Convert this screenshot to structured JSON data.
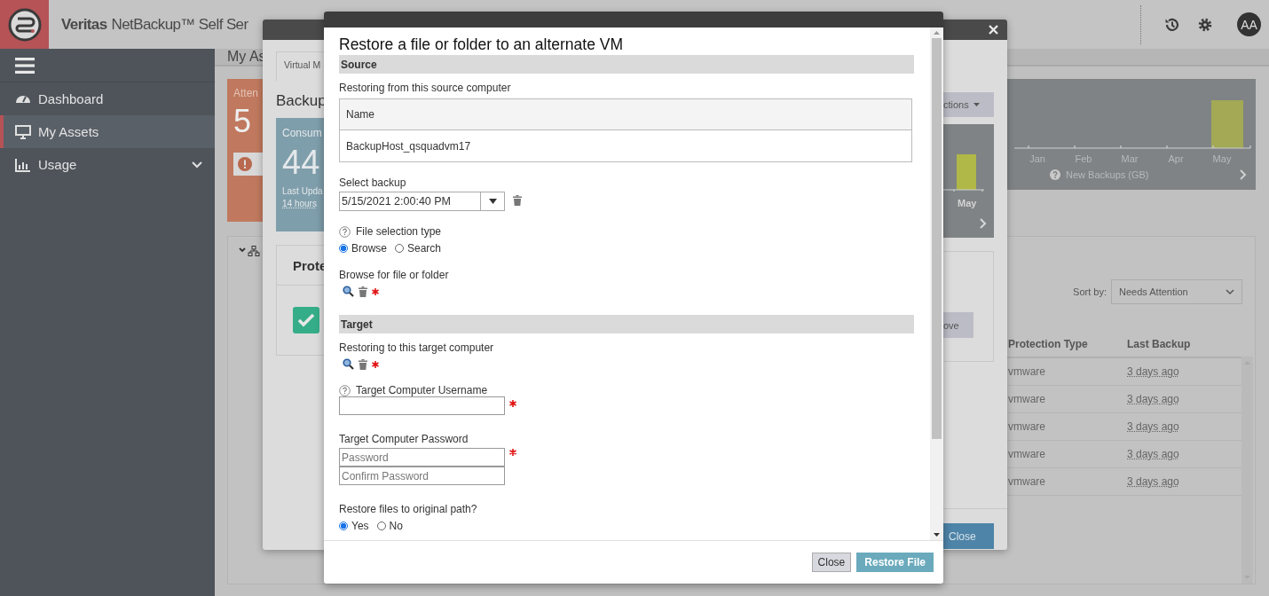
{
  "header": {
    "brand": "Veritas",
    "title": "NetBackup™ Self Ser",
    "avatar": "AA"
  },
  "sidebar": {
    "items": [
      {
        "label": "Dashboard",
        "kind": "dashboard",
        "selected": false,
        "expandable": false
      },
      {
        "label": "My Assets",
        "kind": "monitor",
        "selected": true,
        "expandable": false
      },
      {
        "label": "Usage",
        "kind": "chart",
        "selected": false,
        "expandable": true
      }
    ]
  },
  "page": {
    "breadcrumb": "My As",
    "attention": {
      "label": "Atten",
      "count": "5"
    },
    "chart": {
      "months": [
        "Jan",
        "Feb",
        "Mar",
        "Apr",
        "May"
      ],
      "caption": "New Backups (GB)"
    },
    "sort": {
      "label": "Sort by:",
      "value": "Needs Attention"
    },
    "table": {
      "columns": [
        "Protection Type",
        "Last Backup"
      ],
      "rows": [
        [
          "vmware",
          "3 days ago"
        ],
        [
          "vmware",
          "3 days ago"
        ],
        [
          "vmware",
          "3 days ago"
        ],
        [
          "vmware",
          "3 days ago"
        ],
        [
          "vmware",
          "3 days ago"
        ]
      ]
    }
  },
  "back_dialog": {
    "tab": "Virtual M",
    "title": "Backup",
    "card": {
      "label": "Consum",
      "value": "44",
      "updated": "Last Upda",
      "age": "14 hours"
    },
    "panel_title": "Prote",
    "actions": "ctions",
    "chart_label": "May",
    "remove": "ove",
    "close": "Close"
  },
  "dialog": {
    "title": "Restore a file or folder to an alternate VM",
    "source": {
      "heading": "Source",
      "from_label": "Restoring from this source computer",
      "table": {
        "column": "Name",
        "value": "BackupHost_qsquadvm17"
      },
      "backup_label": "Select backup",
      "backup_value": "5/15/2021 2:00:40 PM",
      "selection_label": "File selection type",
      "selection_options": [
        {
          "label": "Browse",
          "selected": true
        },
        {
          "label": "Search",
          "selected": false
        }
      ],
      "browse_label": "Browse for file or folder",
      "browse_required": true
    },
    "target": {
      "heading": "Target",
      "to_label": "Restoring to this target computer",
      "to_required": true,
      "username_label": "Target Computer Username",
      "username_required": true,
      "password_label": "Target Computer Password",
      "password_placeholder": "Password",
      "confirm_placeholder": "Confirm Password",
      "password_required": true,
      "path_label": "Restore files to original path?",
      "path_options": [
        {
          "label": "Yes",
          "selected": true
        },
        {
          "label": "No",
          "selected": false
        }
      ]
    },
    "buttons": [
      {
        "label": "Close",
        "kind": "secondary"
      },
      {
        "label": "Restore File",
        "kind": "primary"
      }
    ]
  }
}
